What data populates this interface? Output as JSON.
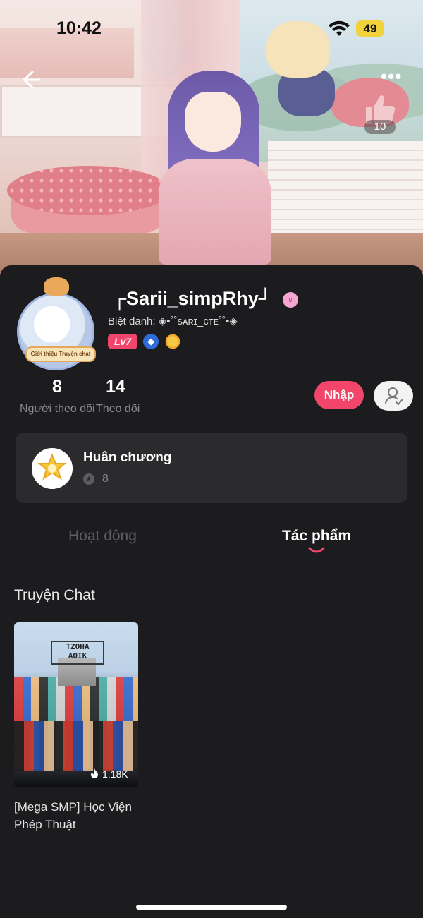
{
  "status_bar": {
    "time": "10:42",
    "battery": "49"
  },
  "header": {
    "likes": "10"
  },
  "profile": {
    "username": "┌Sarii_simpRhy┘",
    "nickname_label": "Biệt danh:",
    "nickname": "◈•˚˚sᴀʀɪ_ᴄᴛᴇ˚˚•◈",
    "level": "Lv7",
    "avatar_tag": "Giới thiệu Truyện chat",
    "followers_count": "8",
    "followers_label": "Người theo dõi",
    "following_count": "14",
    "following_label": "Theo dõi"
  },
  "actions": {
    "login_label": "Nhập"
  },
  "medals": {
    "title": "Huân chương",
    "count": "8"
  },
  "tabs": [
    {
      "label": "Hoạt động",
      "active": false
    },
    {
      "label": "Tác phẩm",
      "active": true
    }
  ],
  "section": {
    "title": "Truyện Chat"
  },
  "stories": [
    {
      "title": "[Mega SMP] Học Viện Phép Thuật",
      "views": "1.18K",
      "cover_text": "TZOHA\nAOIK"
    }
  ],
  "colors": {
    "accent": "#f2456b",
    "background": "#1c1c1e",
    "card": "#2b2b2d"
  }
}
